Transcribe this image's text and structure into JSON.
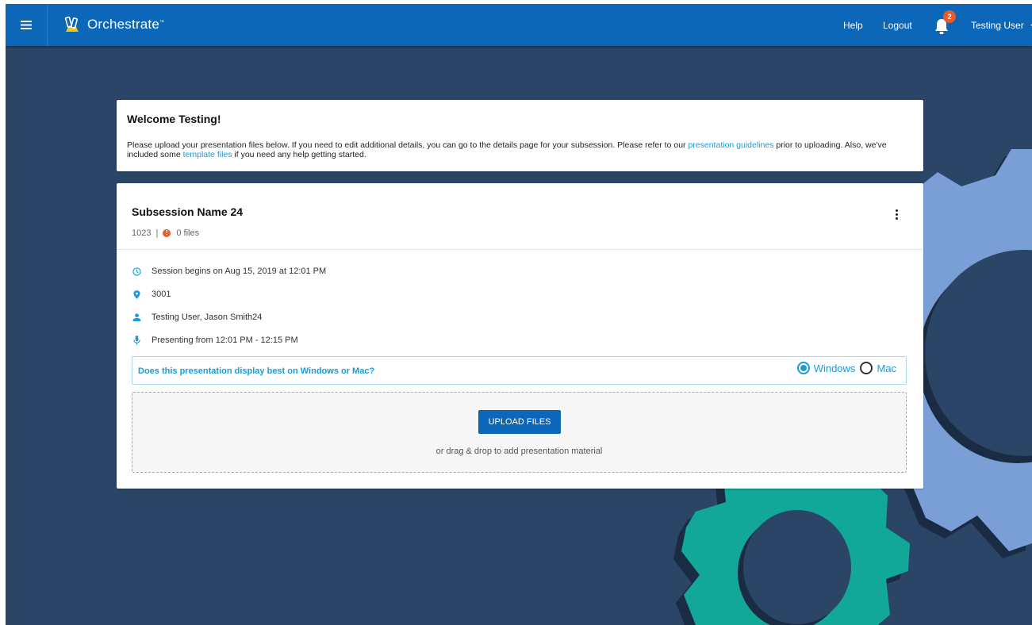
{
  "header": {
    "brand": "Orchestrate",
    "brand_tm": "™",
    "help_label": "Help",
    "logout_label": "Logout",
    "notification_count": "2",
    "user_name": "Testing User"
  },
  "welcome": {
    "title": "Welcome Testing!",
    "text_1": "Please upload your presentation files below. If you need to edit additional details, you can go to the details page for your subsession. Please refer to our ",
    "link_guidelines": "presentation guidelines",
    "text_2": " prior to uploading. Also, we've included some ",
    "link_templates": "template files",
    "text_3": " if you need any help getting started."
  },
  "session": {
    "title": "Subsession Name 24",
    "code": "1023",
    "separator": "|",
    "files": "0 files",
    "details": {
      "time": "Session begins on Aug 15, 2019 at 12:01 PM",
      "room": "3001",
      "presenters": "Testing User, Jason Smith24",
      "presenting": "Presenting from 12:01 PM - 12:15 PM"
    },
    "os_question": "Does this presentation display best on Windows or Mac?",
    "os_options": [
      {
        "label": "Windows",
        "selected": true
      },
      {
        "label": "Mac",
        "selected": false
      }
    ],
    "upload_label": "UPLOAD FILES",
    "drop_hint": "or drag & drop to add presentation material"
  },
  "colors": {
    "header_bg": "#0d67b8",
    "page_bg": "#2b4567",
    "link": "#1a9bd8",
    "alert": "#e85c27",
    "gear_blue": "#7a9fd6",
    "gear_teal": "#12a899"
  },
  "icons": [
    "hamburger-icon",
    "orchestrate-logo-icon",
    "bell-icon",
    "chevron-down-icon",
    "kebab-menu-icon",
    "error-icon",
    "clock-icon",
    "location-pin-icon",
    "person-icon",
    "microphone-icon",
    "radio-checked-icon",
    "radio-unchecked-icon"
  ]
}
